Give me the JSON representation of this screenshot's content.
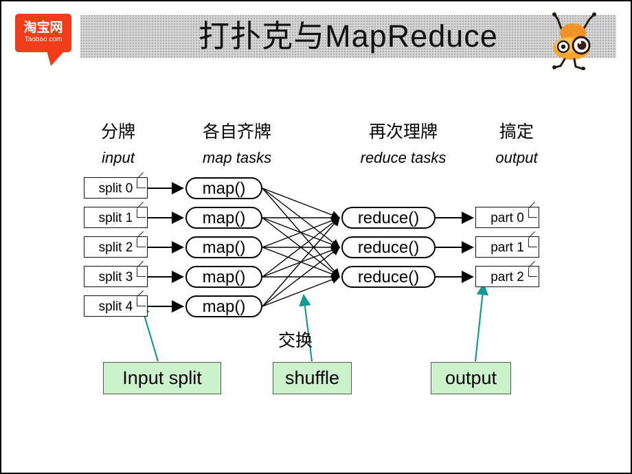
{
  "slide": {
    "title": "打扑克与MapReduce",
    "logo": {
      "cn": "淘宝网",
      "en": "Taobao.com",
      "color": "#f03c18",
      "name": "taobao-logo"
    },
    "mascot": {
      "name": "ant-mascot",
      "color": "#f5a623"
    },
    "title_band_color": "#d4d4d4"
  },
  "columns": [
    {
      "cn": "分牌",
      "en": "input"
    },
    {
      "cn": "各自齐牌",
      "en": "map tasks"
    },
    {
      "cn": "再次理牌",
      "en": "reduce tasks"
    },
    {
      "cn": "搞定",
      "en": "output"
    }
  ],
  "splits": [
    {
      "label": "split 0"
    },
    {
      "label": "split 1"
    },
    {
      "label": "split 2"
    },
    {
      "label": "split 3"
    },
    {
      "label": "split 4"
    }
  ],
  "maps": [
    {
      "label": "map()"
    },
    {
      "label": "map()"
    },
    {
      "label": "map()"
    },
    {
      "label": "map()"
    },
    {
      "label": "map()"
    }
  ],
  "reduces": [
    {
      "label": "reduce()"
    },
    {
      "label": "reduce()"
    },
    {
      "label": "reduce()"
    }
  ],
  "parts": [
    {
      "label": "part 0"
    },
    {
      "label": "part 1"
    },
    {
      "label": "part 2"
    }
  ],
  "callouts": {
    "input_split": "Input split",
    "shuffle": "shuffle",
    "output": "output",
    "swap_cn": "交换",
    "fill": "#ccf2cc",
    "pointer_color": "#159a92"
  }
}
